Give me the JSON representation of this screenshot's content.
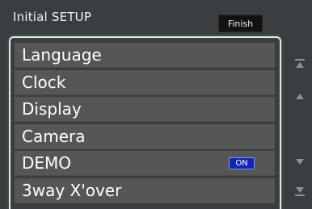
{
  "header": {
    "title": "Initial SETUP",
    "finish_label": "Finish"
  },
  "menu": {
    "items": [
      {
        "label": "Language"
      },
      {
        "label": "Clock"
      },
      {
        "label": "Display"
      },
      {
        "label": "Camera"
      },
      {
        "label": "DEMO",
        "toggle": "ON"
      },
      {
        "label": "3way X'over"
      }
    ]
  },
  "scrollbar": {
    "icons": [
      "scroll-to-top-icon",
      "scroll-up-icon",
      "scroll-down-icon",
      "scroll-to-bottom-icon"
    ]
  },
  "colors": {
    "background": "#3b3e40",
    "item_background": "#545657",
    "frame_highlight": "#d7efe6",
    "on_badge": "#1126b8"
  }
}
